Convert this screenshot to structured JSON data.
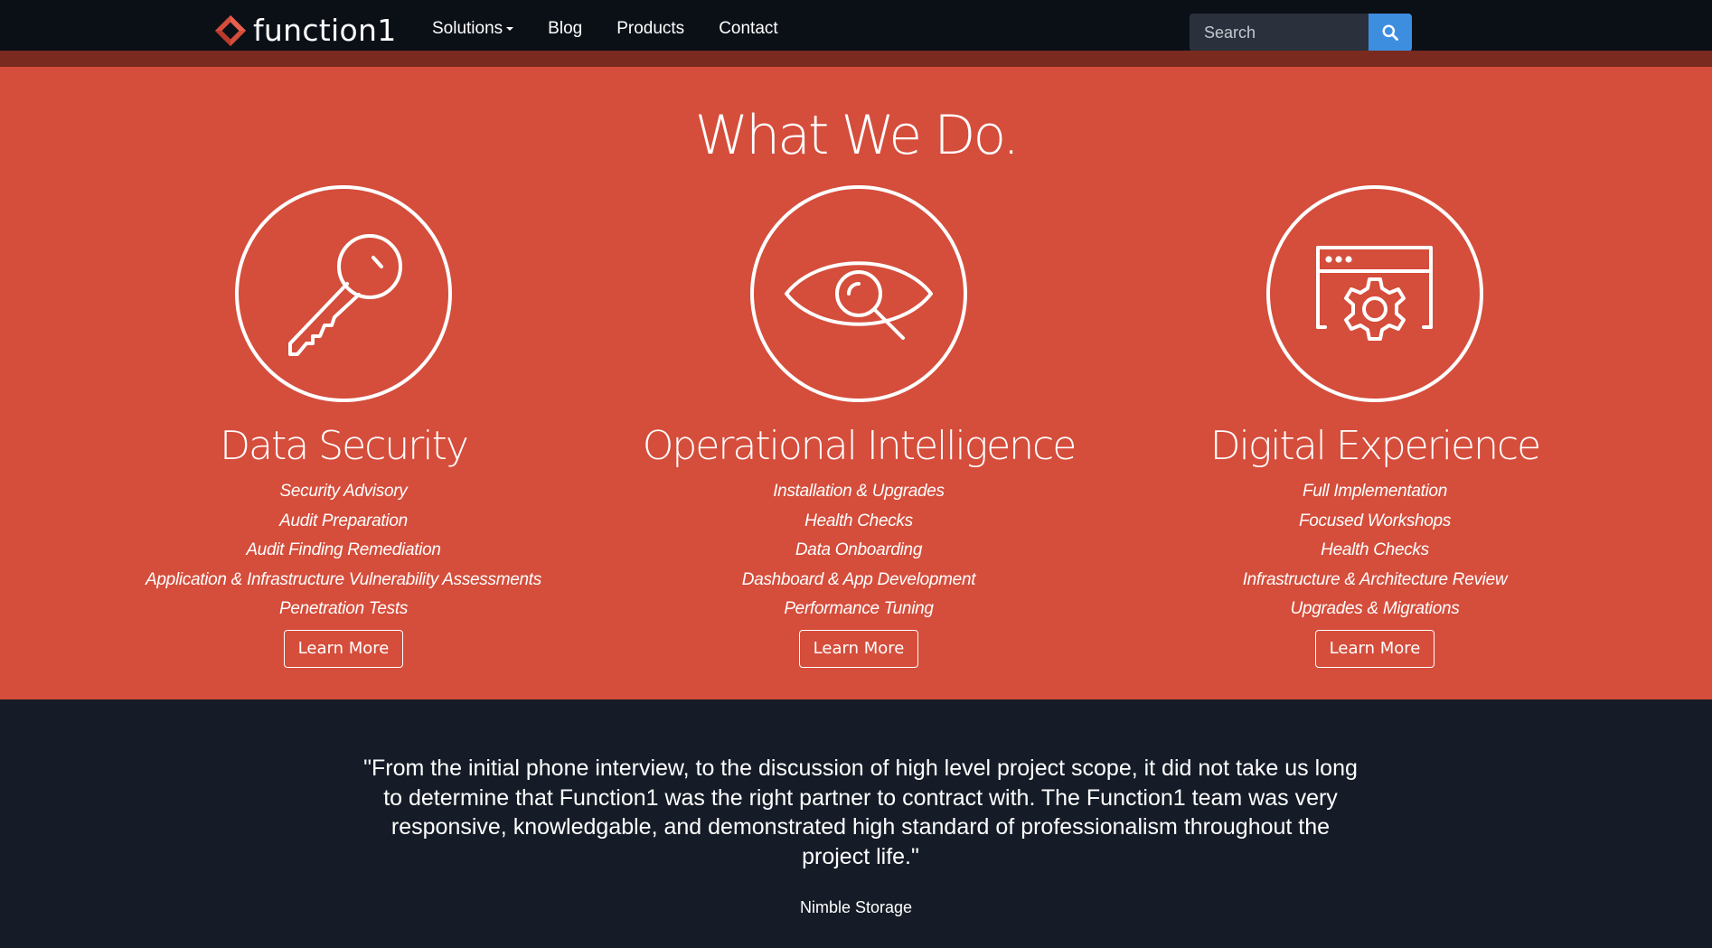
{
  "navbar": {
    "brand": "function1",
    "items": [
      {
        "label": "Solutions"
      },
      {
        "label": "Blog"
      },
      {
        "label": "Products"
      },
      {
        "label": "Contact"
      }
    ],
    "search": {
      "placeholder": "Search"
    }
  },
  "hero": {
    "title": "What We Do.",
    "services": [
      {
        "title": "Data Security",
        "icon": "key-icon",
        "items": [
          "Security Advisory",
          "Audit Preparation",
          "Audit Finding Remediation",
          "Application & Infrastructure Vulnerability Assessments",
          "Penetration Tests"
        ],
        "button": "Learn More"
      },
      {
        "title": "Operational Intelligence",
        "icon": "eye-magnifier-icon",
        "items": [
          "Installation & Upgrades",
          "Health Checks",
          "Data Onboarding",
          "Dashboard & App Development",
          "Performance Tuning"
        ],
        "button": "Learn More"
      },
      {
        "title": "Digital Experience",
        "icon": "browser-gear-icon",
        "items": [
          "Full Implementation",
          "Focused Workshops",
          "Health Checks",
          "Infrastructure & Architecture Review",
          "Upgrades & Migrations"
        ],
        "button": "Learn More"
      }
    ]
  },
  "testimonial": {
    "quote": "\"From the initial phone interview, to the discussion of high level project scope, it did not take us long to determine that Function1 was the right partner to contract with. The Function1 team was very responsive, knowledgable, and demonstrated high standard of professionalism throughout the project life.\"",
    "author": "Nimble Storage"
  },
  "colors": {
    "navbar": "#0b1017",
    "hero": "#d54d3b",
    "search_button": "#3e8ee0",
    "testimonial": "#151c27"
  }
}
